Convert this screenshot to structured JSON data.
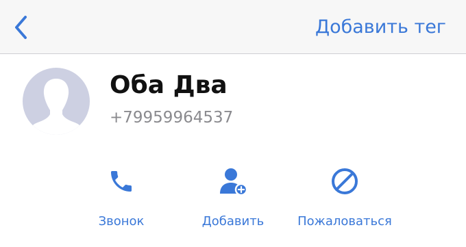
{
  "nav": {
    "back_icon": "chevron-left-icon",
    "add_tag_label": "Добавить тег"
  },
  "contact": {
    "name": "Оба Два",
    "phone": "+79959964537",
    "avatar_icon": "default-avatar-silhouette"
  },
  "actions": [
    {
      "label": "Звонок",
      "icon": "phone-icon"
    },
    {
      "label": "Добавить",
      "icon": "add-contact-icon"
    },
    {
      "label": "Пожаловаться",
      "icon": "block-icon"
    }
  ],
  "colors": {
    "accent": "#3a78d8",
    "avatar_bg": "#cdd0e2",
    "avatar_silhouette": "#ffffff",
    "secondary_text": "#8a8a8e",
    "nav_bg": "#f7f7f7"
  }
}
